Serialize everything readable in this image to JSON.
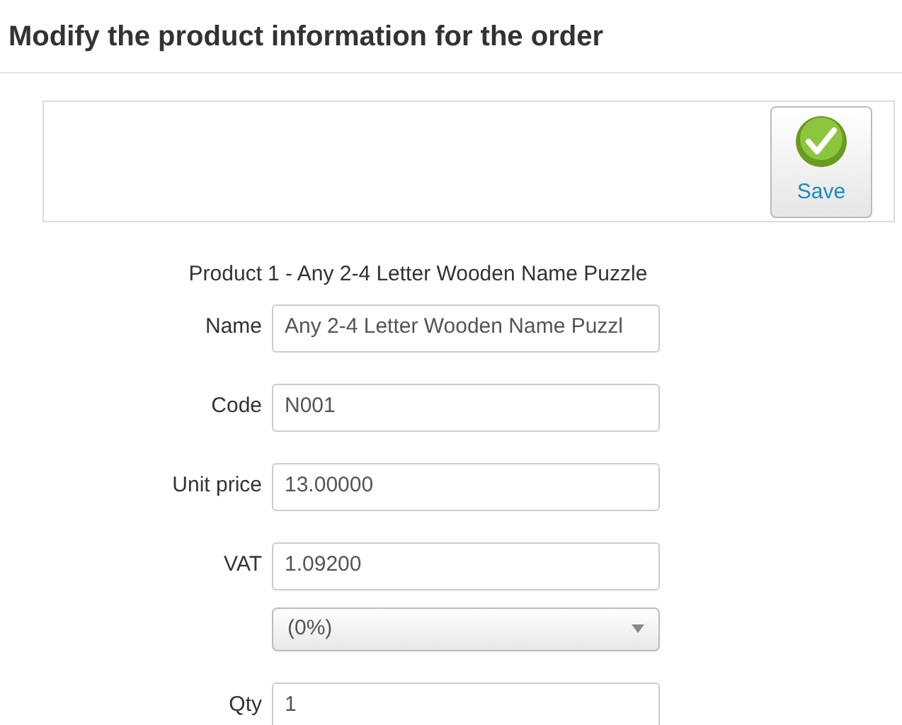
{
  "page_title": "Modify the product information for the order",
  "toolbar": {
    "save_button": "Save"
  },
  "product": {
    "label": "Product",
    "value": "1 - Any 2-4 Letter Wooden Name Puzzle"
  },
  "fields": [
    {
      "kind": "text",
      "label": "Name",
      "value": "Any 2-4 Letter Wooden Name Puzzl"
    },
    {
      "kind": "text",
      "label": "Code",
      "value": "N001"
    },
    {
      "kind": "text",
      "label": "Unit price",
      "value": "13.00000"
    },
    {
      "kind": "text",
      "label": "VAT",
      "value": "1.09200"
    },
    {
      "kind": "select",
      "value": "(0%)"
    },
    {
      "kind": "text",
      "label": "Qty",
      "value": "1"
    }
  ]
}
